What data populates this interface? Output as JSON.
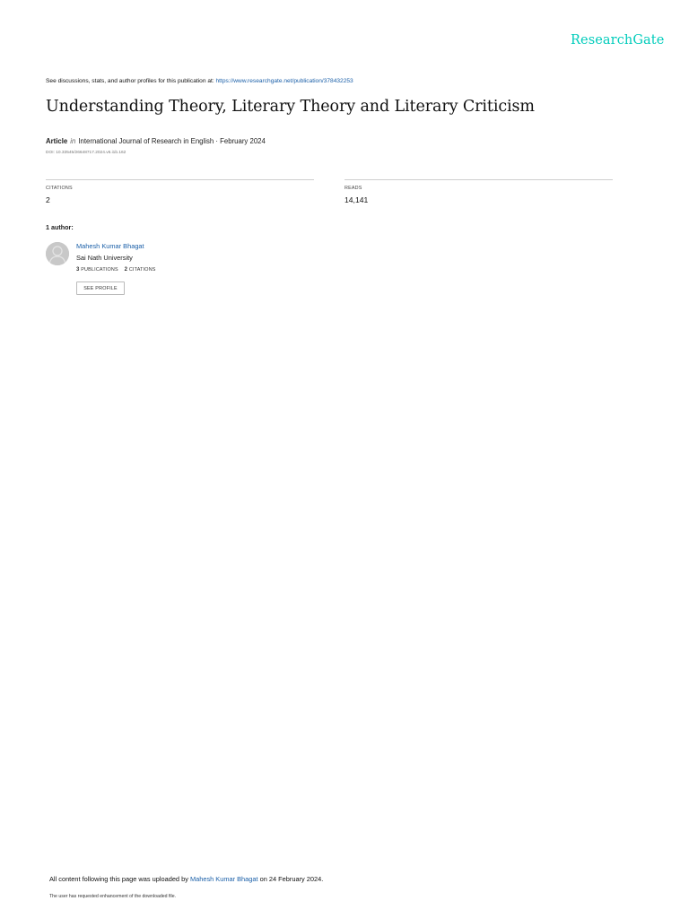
{
  "brand": {
    "logo_text": "ResearchGate",
    "color": "#00ccbb"
  },
  "header": {
    "intro": "See discussions, stats, and author profiles for this publication at: ",
    "url": "https://www.researchgate.net/publication/378432253"
  },
  "publication": {
    "title": "Understanding Theory, Literary Theory and Literary Criticism",
    "type": "Article",
    "in": "in",
    "journal_date": "International Journal of Research in English · February 2024",
    "doi": "DOI: 10.33545/26648717.2024.v6.i1b.162"
  },
  "stats": {
    "citations_label": "CITATIONS",
    "citations_value": "2",
    "reads_label": "READS",
    "reads_value": "14,141"
  },
  "authors": {
    "heading": "1 author:",
    "list": [
      {
        "name": "Mahesh Kumar Bhagat",
        "affiliation": "Sai Nath University",
        "publications_count": "3",
        "publications_label": "PUBLICATIONS",
        "citations_count": "2",
        "citations_label": "CITATIONS",
        "button_label": "SEE PROFILE"
      }
    ]
  },
  "footer": {
    "uploaded_prefix": "All content following this page was uploaded by ",
    "uploader": "Mahesh Kumar Bhagat",
    "uploaded_suffix": " on 24 February 2024.",
    "note": "The user has requested enhancement of the downloaded file."
  },
  "colors": {
    "link": "#1a5fa8",
    "divider": "#cfcfcf",
    "avatar": "#c8c8c8"
  }
}
